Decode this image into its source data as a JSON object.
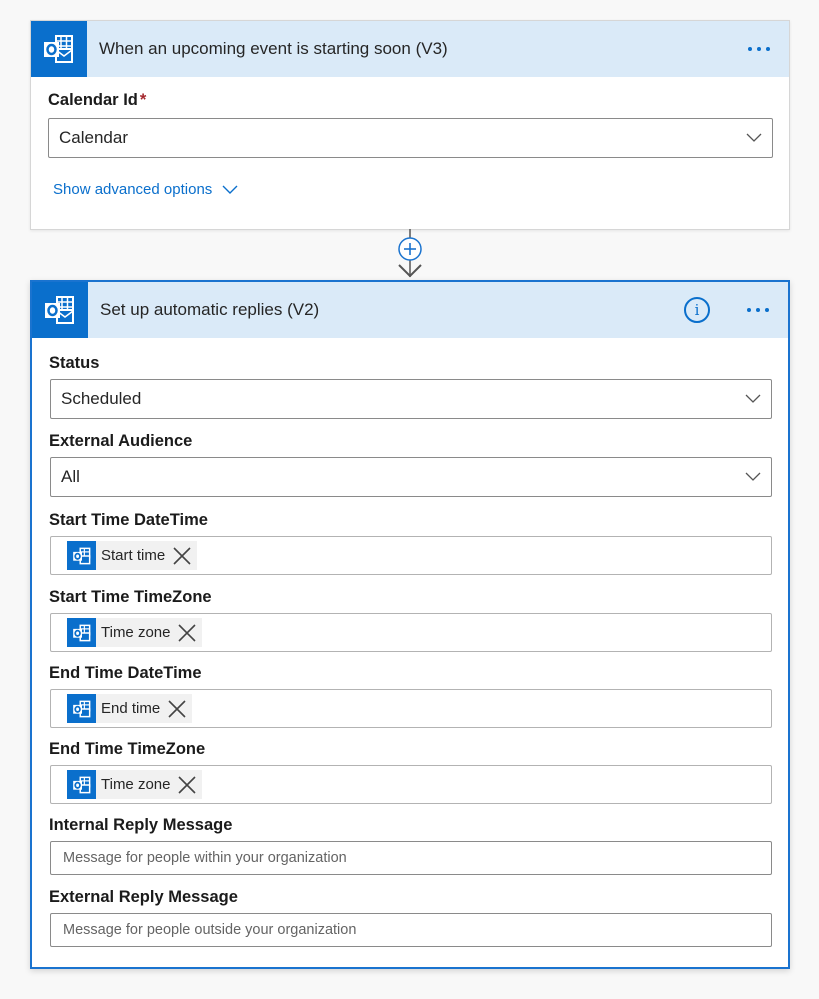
{
  "trigger": {
    "title": "When an upcoming event is starting soon (V3)",
    "icon": "outlook-icon",
    "more_icon": "ellipsis-icon",
    "fields": {
      "calendar_id": {
        "label": "Calendar Id",
        "required_marker": "*",
        "value": "Calendar"
      }
    },
    "advanced_options_label": "Show advanced options"
  },
  "connector": {
    "icon": "add-step-icon"
  },
  "action": {
    "title": "Set up automatic replies (V2)",
    "icon": "outlook-icon",
    "info_icon": "info-icon",
    "info_glyph": "i",
    "more_icon": "ellipsis-icon",
    "fields": {
      "status": {
        "label": "Status",
        "value": "Scheduled"
      },
      "external_audience": {
        "label": "External Audience",
        "value": "All"
      },
      "start_time_datetime": {
        "label": "Start Time DateTime",
        "token": "Start time"
      },
      "start_time_timezone": {
        "label": "Start Time TimeZone",
        "token": "Time zone"
      },
      "end_time_datetime": {
        "label": "End Time DateTime",
        "token": "End time"
      },
      "end_time_timezone": {
        "label": "End Time TimeZone",
        "token": "Time zone"
      },
      "internal_reply_message": {
        "label": "Internal Reply Message",
        "placeholder": "Message for people within your organization",
        "value": ""
      },
      "external_reply_message": {
        "label": "External Reply Message",
        "placeholder": "Message for people outside your organization",
        "value": ""
      }
    }
  },
  "colors": {
    "accent": "#0a6fcc",
    "header_bg": "#daeaf8",
    "selected_border": "#1a73cf",
    "required": "#a4262c",
    "page_bg": "#f8f8f8"
  }
}
